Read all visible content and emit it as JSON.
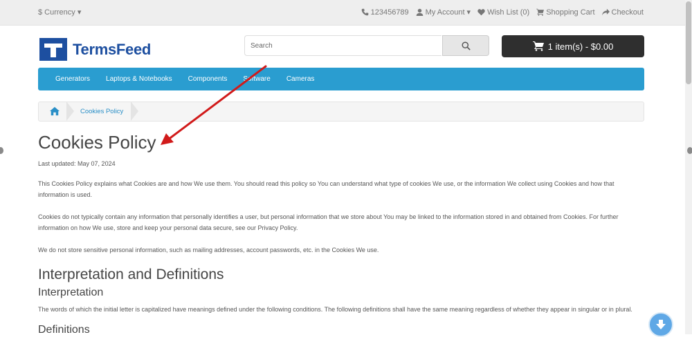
{
  "topbar": {
    "currency": "$ Currency",
    "phone": "123456789",
    "account": "My Account",
    "wishlist": "Wish List (0)",
    "cart": "Shopping Cart",
    "checkout": "Checkout"
  },
  "header": {
    "logo": "TermsFeed",
    "search_placeholder": "Search",
    "cart_button": "1 item(s) - $0.00"
  },
  "menu": [
    "Generators",
    "Laptops & Notebooks",
    "Components",
    "Software",
    "Cameras"
  ],
  "breadcrumb": {
    "current": "Cookies Policy"
  },
  "page": {
    "title": "Cookies Policy",
    "updated": "Last updated: May 07, 2024",
    "p1": "This Cookies Policy explains what Cookies are and how We use them. You should read this policy so You can understand what type of cookies We use, or the information We collect using Cookies and how that information is used.",
    "p2": "Cookies do not typically contain any information that personally identifies a user, but personal information that we store about You may be linked to the information stored in and obtained from Cookies. For further information on how We use, store and keep your personal data secure, see our Privacy Policy.",
    "p3": "We do not store sensitive personal information, such as mailing addresses, account passwords, etc. in the Cookies We use.",
    "h2": "Interpretation and Definitions",
    "h3": "Interpretation",
    "p4": "The words of which the initial letter is capitalized have meanings defined under the following conditions. The following definitions shall have the same meaning regardless of whether they appear in singular or in plural.",
    "h3b": "Definitions"
  },
  "colors": {
    "menu_bg": "#2a9dd0",
    "brand": "#1d4fa0",
    "cart_bg": "#2f2f2f",
    "annotation_arrow": "#d11a1a"
  },
  "icons": [
    "phone-icon",
    "user-icon",
    "heart-icon",
    "cart-icon",
    "share-icon",
    "search-icon",
    "home-icon",
    "arrow-down-icon"
  ]
}
